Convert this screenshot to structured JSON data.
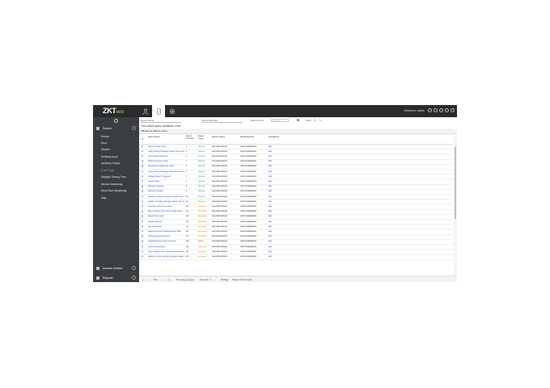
{
  "app": {
    "logo_main": "ZKT",
    "logo_sub": "eco",
    "welcome": "Welcome, admin"
  },
  "sidebar": {
    "sections": [
      {
        "label": "Device"
      },
      {
        "label": "Access Control"
      },
      {
        "label": "Reports"
      }
    ],
    "items": [
      {
        "label": "Device",
        "active": false
      },
      {
        "label": "Door",
        "active": false
      },
      {
        "label": "Reader",
        "active": false
      },
      {
        "label": "Auxiliary Input",
        "active": false
      },
      {
        "label": "Auxiliary Output",
        "active": false
      },
      {
        "label": "Event Type",
        "active": true
      },
      {
        "label": "Daylight Saving Time",
        "active": false
      },
      {
        "label": "Device Monitoring",
        "active": false
      },
      {
        "label": "Real-Time Monitoring",
        "active": false
      },
      {
        "label": "Map",
        "active": false
      }
    ]
  },
  "search": {
    "event_name_label": "Event Name",
    "event_number_label": "Event Number",
    "event_level_label": "Event Level",
    "event_level_value": "Choose",
    "more_label": "More",
    "condition_text": "The current query conditions: none"
  },
  "toolbar": {
    "refresh": "Refresh",
    "set_audio": "Set Audio"
  },
  "table": {
    "headers": [
      "Event Name",
      "Event Number",
      "Event Level",
      "Device Name",
      "Serial Number",
      "Operations"
    ],
    "rows": [
      {
        "name": "Normal Verify Open",
        "number": "0",
        "level": "Normal",
        "device": "192.168.218.100",
        "serial": "AJP F192200001",
        "op": "Edit"
      },
      {
        "name": "Verify During Passage Mode Time Zone",
        "number": "1",
        "level": "Normal",
        "device": "192.168.218.100",
        "serial": "AJP F192200001",
        "op": "Edit"
      },
      {
        "name": "First-Personnel Open",
        "number": "2",
        "level": "Normal",
        "device": "192.168.218.100",
        "serial": "AJP F192200001",
        "op": "Edit"
      },
      {
        "name": "Multi-Personnel Open",
        "number": "3",
        "level": "Normal",
        "device": "192.168.218.100",
        "serial": "AJP F192200001",
        "op": "Edit"
      },
      {
        "name": "Emergency Password Open",
        "number": "4",
        "level": "Normal",
        "device": "192.168.218.100",
        "serial": "AJP F192200001",
        "op": "Edit"
      },
      {
        "name": "Open during Passage Mode Time Zone",
        "number": "5",
        "level": "Normal",
        "device": "192.168.218.100",
        "serial": "AJP F192200001",
        "op": "Edit"
      },
      {
        "name": "Linkage Event Triggered",
        "number": "6",
        "level": "Normal",
        "device": "192.168.218.100",
        "serial": "AJP F192200001",
        "op": "Edit"
      },
      {
        "name": "Cancel Alarm",
        "number": "7",
        "level": "Normal",
        "device": "192.168.218.100",
        "serial": "AJP F192200001",
        "op": "Edit"
      },
      {
        "name": "Remote Opening",
        "number": "8",
        "level": "Normal",
        "device": "192.168.218.100",
        "serial": "AJP F192200001",
        "op": "Edit"
      },
      {
        "name": "Remote Closing",
        "number": "9",
        "level": "Normal",
        "device": "192.168.218.100",
        "serial": "AJP F192200001",
        "op": "Edit"
      },
      {
        "name": "Disable Intraday Passage Mode Time Zone",
        "number": "10",
        "level": "Normal",
        "device": "192.168.218.100",
        "serial": "AJP F192200001",
        "op": "Edit"
      },
      {
        "name": "Enable Intraday Passage Mode Time Zone",
        "number": "11",
        "level": "Normal",
        "device": "192.168.218.100",
        "serial": "AJP F192200001",
        "op": "Edit"
      },
      {
        "name": "Operate Interval too Short",
        "number": "20",
        "level": "Exception",
        "device": "192.168.218.100",
        "serial": "AJP F192200001",
        "op": "Edit"
      },
      {
        "name": "Door Inactive Time Zone Verify Open",
        "number": "21",
        "level": "Exception",
        "device": "192.168.218.100",
        "serial": "AJP F192200001",
        "op": "Edit"
      },
      {
        "name": "Illegal Time Zone",
        "number": "22",
        "level": "Exception",
        "device": "192.168.218.100",
        "serial": "AJP F192200001",
        "op": "Edit"
      },
      {
        "name": "Access Denied",
        "number": "23",
        "level": "Exception",
        "device": "192.168.218.100",
        "serial": "AJP F192200001",
        "op": "Edit"
      },
      {
        "name": "Anti-Passback",
        "number": "24",
        "level": "Exception",
        "device": "192.168.218.100",
        "serial": "AJP F192200001",
        "op": "Edit"
      },
      {
        "name": "Multi-Personnel Authentication Wait",
        "number": "26",
        "level": "Exception",
        "device": "192.168.218.100",
        "serial": "AJP F192200001",
        "op": "Edit"
      },
      {
        "name": "Unregistered Personnel",
        "number": "27",
        "level": "Exception",
        "device": "192.168.218.100",
        "serial": "AJP F192200001",
        "op": "Edit"
      },
      {
        "name": "Unlocked Open Door Timeout",
        "number": "28",
        "level": "Alarm",
        "device": "192.168.218.100",
        "serial": "AJP F192200001",
        "op": "Edit"
      },
      {
        "name": "Personnel Expired",
        "number": "29",
        "level": "Exception",
        "device": "192.168.218.100",
        "serial": "AJP F192200001",
        "op": "Edit"
      },
      {
        "name": "Door Inactive Time Zone(Press Exit Button)",
        "number": "30",
        "level": "Exception",
        "device": "192.168.218.100",
        "serial": "AJP F192200001",
        "op": "Edit"
      },
      {
        "name": "Failed to Close during Passage Mode Time Zone",
        "number": "31",
        "level": "Exception",
        "device": "192.168.218.100",
        "serial": "AJP F192200001",
        "op": "Edit"
      }
    ]
  },
  "pager": {
    "page_input": "1/8",
    "per_page": "50 rows per page",
    "jump_label": "Jump To",
    "jump_value": "1",
    "page_suffix": "/8 Page",
    "total": "Total of 377 records"
  }
}
